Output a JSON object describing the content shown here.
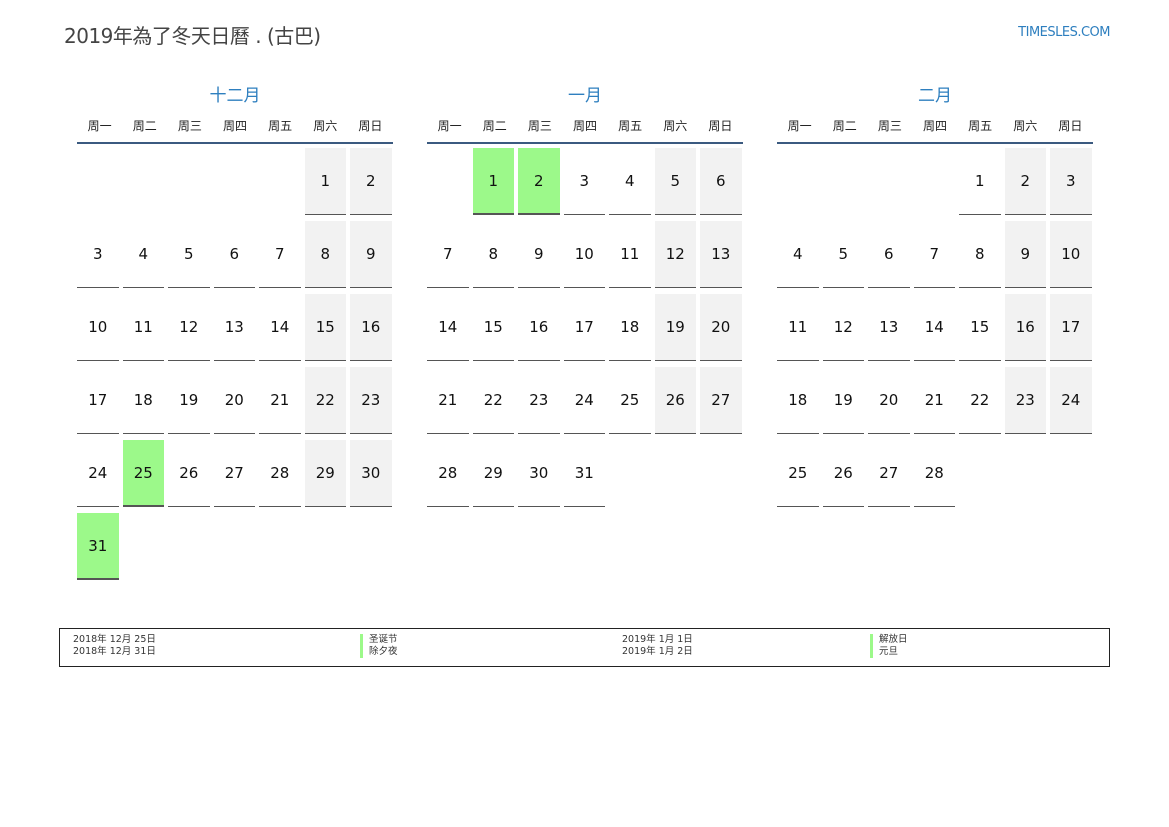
{
  "header": {
    "title": "2019年為了冬天日曆 . (古巴)",
    "site": "TIMESLES.COM"
  },
  "weekdays": [
    "周一",
    "周二",
    "周三",
    "周四",
    "周五",
    "周六",
    "周日"
  ],
  "colors": {
    "accent": "#2e7fbf",
    "holiday": "#9cf98a",
    "weekend": "#f2f2f2"
  },
  "months": [
    {
      "name": "十二月",
      "offset": 5,
      "days": [
        "1",
        "2",
        "3",
        "4",
        "5",
        "6",
        "7",
        "8",
        "9",
        "10",
        "11",
        "12",
        "13",
        "14",
        "15",
        "16",
        "17",
        "18",
        "19",
        "20",
        "21",
        "22",
        "23",
        "24",
        "25",
        "26",
        "27",
        "28",
        "29",
        "30",
        "31"
      ],
      "holidays": [
        25,
        31
      ]
    },
    {
      "name": "一月",
      "offset": 1,
      "days": [
        "1",
        "2",
        "3",
        "4",
        "5",
        "6",
        "7",
        "8",
        "9",
        "10",
        "11",
        "12",
        "13",
        "14",
        "15",
        "16",
        "17",
        "18",
        "19",
        "20",
        "21",
        "22",
        "23",
        "24",
        "25",
        "26",
        "27",
        "28",
        "29",
        "30",
        "31"
      ],
      "holidays": [
        1,
        2
      ]
    },
    {
      "name": "二月",
      "offset": 4,
      "days": [
        "1",
        "2",
        "3",
        "4",
        "5",
        "6",
        "7",
        "8",
        "9",
        "10",
        "11",
        "12",
        "13",
        "14",
        "15",
        "16",
        "17",
        "18",
        "19",
        "20",
        "21",
        "22",
        "23",
        "24",
        "25",
        "26",
        "27",
        "28"
      ],
      "holidays": []
    }
  ],
  "legend": {
    "col1_dates": [
      "2018年 12月 25日",
      "2018年 12月 31日"
    ],
    "col1_names": [
      "圣诞节",
      "除夕夜"
    ],
    "col2_dates": [
      "2019年 1月 1日",
      "2019年 1月 2日"
    ],
    "col2_names": [
      "解放日",
      "元旦"
    ]
  }
}
